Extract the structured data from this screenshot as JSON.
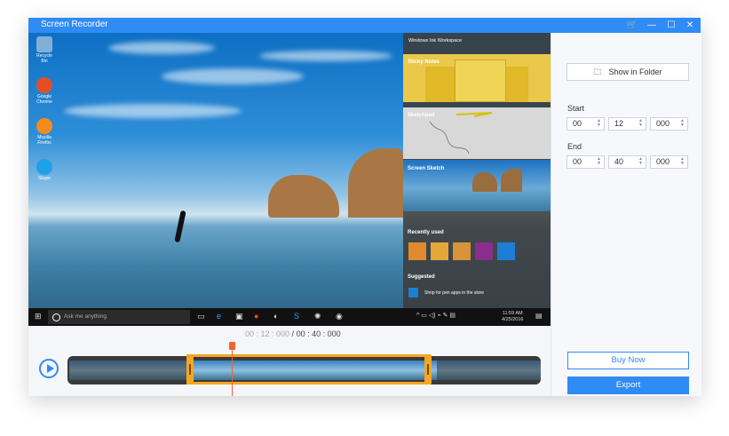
{
  "app": {
    "title": "Screen Recorder"
  },
  "window_controls": {
    "cart": "🛒",
    "minimize": "—",
    "maximize": "☐",
    "close": "✕"
  },
  "desktop": {
    "icons": [
      {
        "label": "Recycle Bin",
        "color": "#7fb0d8"
      },
      {
        "label": "Google Chrome",
        "color": "#e44d26"
      },
      {
        "label": "Mozilla Firefox",
        "color": "#f28c1c"
      },
      {
        "label": "Skype",
        "color": "#1ea1e6"
      }
    ]
  },
  "ink_workspace": {
    "header": "Windows Ink Workspace",
    "sticky_notes": "Sticky Notes",
    "sketchpad": "Sketchpad",
    "screen_sketch": "Screen Sketch",
    "recently_used": "Recently used",
    "suggested": "Suggested",
    "suggested_item": "Shop for pen apps in the store",
    "app_colors": [
      "#e08a2e",
      "#e6a63a",
      "#d9933a",
      "#8a2d8c",
      "#1c7fd6"
    ]
  },
  "taskbar": {
    "search_placeholder": "Ask me anything",
    "time": "11:59 AM",
    "date": "4/25/2016"
  },
  "timeline": {
    "current_time": "00 : 12 : 000",
    "separator": " / ",
    "total_time": "00 : 40 : 000",
    "selection_start_fraction": 0.3,
    "selection_end_fraction": 0.75
  },
  "panel": {
    "show_in_folder": "Show in Folder",
    "start_label": "Start",
    "end_label": "End",
    "start": {
      "hours": "00",
      "minutes": "12",
      "millis": "000"
    },
    "end": {
      "hours": "00",
      "minutes": "40",
      "millis": "000"
    },
    "buy_now": "Buy Now",
    "export": "Export"
  },
  "colors": {
    "accent": "#2f8cf5",
    "selection": "#f5a623",
    "playhead": "#f0652f"
  }
}
